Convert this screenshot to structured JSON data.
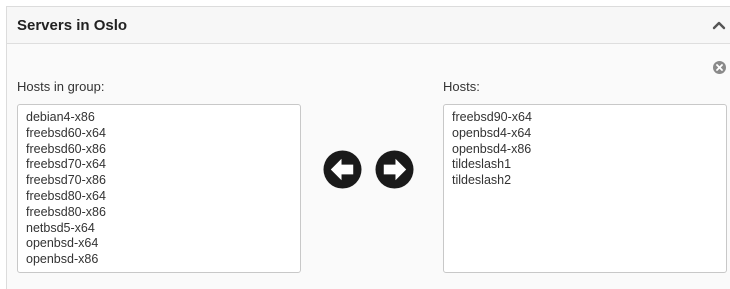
{
  "panel": {
    "title": "Servers in Oslo",
    "collapse_icon": "chevron-up-icon",
    "close_icon": "close-circle-icon"
  },
  "left": {
    "label": "Hosts in group:",
    "items": [
      "debian4-x86",
      "freebsd60-x64",
      "freebsd60-x86",
      "freebsd70-x64",
      "freebsd70-x86",
      "freebsd80-x64",
      "freebsd80-x86",
      "netbsd5-x64",
      "openbsd-x64",
      "openbsd-x86"
    ]
  },
  "right": {
    "label": "Hosts:",
    "items": [
      "freebsd90-x64",
      "openbsd4-x64",
      "openbsd4-x86",
      "tildeslash1",
      "tildeslash2"
    ]
  },
  "controls": {
    "move_left_icon": "arrow-left-circle-icon",
    "move_right_icon": "arrow-right-circle-icon"
  },
  "colors": {
    "button": "#1a1a1a",
    "icon_gray": "#8a8a8a"
  }
}
